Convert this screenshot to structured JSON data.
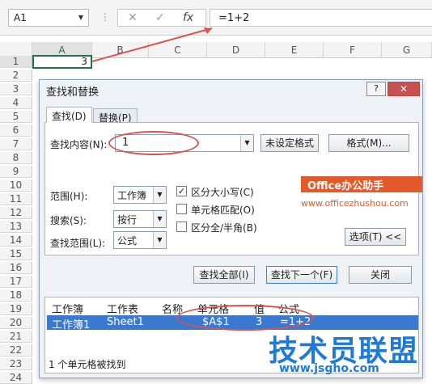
{
  "formula_bar": {
    "name_box": "A1",
    "cancel_glyph": "✕",
    "enter_glyph": "✓",
    "fx_glyph": "fx",
    "formula": "=1+2"
  },
  "sheet": {
    "columns": [
      "A",
      "B",
      "C",
      "D",
      "E",
      "F",
      "G"
    ],
    "rows": [
      "1",
      "2",
      "3",
      "4",
      "5",
      "6",
      "7",
      "8",
      "9",
      "10",
      "11",
      "12",
      "13",
      "14",
      "15",
      "16",
      "17",
      "18",
      "19",
      "20",
      "21",
      "22",
      "23",
      "24"
    ],
    "a1_value": "3"
  },
  "dialog": {
    "title": "查找和替换",
    "help_label": "?",
    "close_label": "✕",
    "tabs": [
      "查找(D)",
      "替换(P)"
    ],
    "find_label": "查找内容(N):",
    "find_value": "1",
    "format_status": "未设定格式",
    "format_button": "格式(M)...",
    "scope_label": "范围(H):",
    "scope_value": "工作簿",
    "search_label": "搜索(S):",
    "search_value": "按行",
    "lookin_label": "查找范围(L):",
    "lookin_value": "公式",
    "match_case": "区分大小写(C)",
    "match_cell": "单元格匹配(O)",
    "match_width": "区分全/半角(B)",
    "options_button": "选项(T) <<",
    "find_all": "查找全部(I)",
    "find_next": "查找下一个(F)",
    "close_button": "关闭",
    "results_headers": [
      "工作簿",
      "工作表",
      "名称",
      "单元格",
      "值",
      "公式"
    ],
    "results_row": [
      "工作簿1",
      "Sheet1",
      "",
      "$A$1",
      "3",
      "=1+2"
    ],
    "status": "1 个单元格被找到"
  },
  "watermarks": {
    "office_banner": "Office办公助手",
    "office_site": "www.officezhushou.com",
    "brand": "技术员联盟",
    "brand_site": "www.jsgho.com"
  },
  "colors": {
    "selection": "#3b78d0",
    "annotation": "#d9534f",
    "excel_green": "#217346"
  }
}
